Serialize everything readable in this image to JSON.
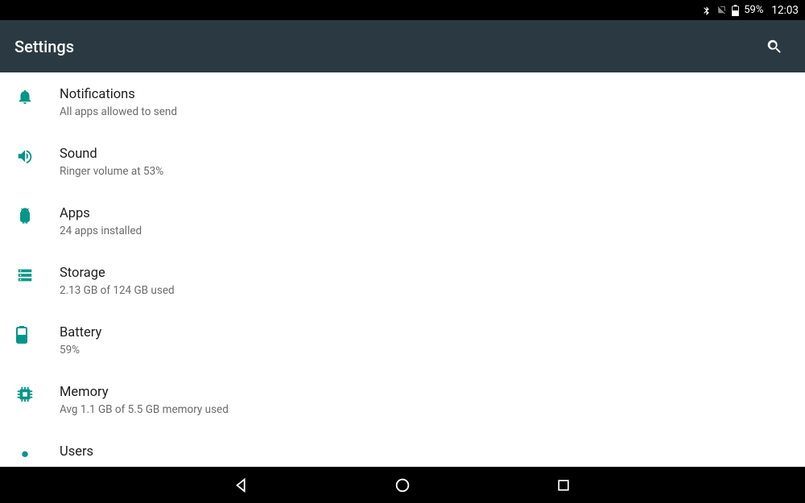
{
  "statusbar": {
    "battery_pct": "59%",
    "time": "12:03"
  },
  "appbar": {
    "title": "Settings"
  },
  "colors": {
    "accent": "#009688"
  },
  "items": [
    {
      "key": "notifications",
      "title": "Notifications",
      "sub": "All apps allowed to send",
      "icon": "bell-icon"
    },
    {
      "key": "sound",
      "title": "Sound",
      "sub": "Ringer volume at 53%",
      "icon": "volume-icon"
    },
    {
      "key": "apps",
      "title": "Apps",
      "sub": "24 apps installed",
      "icon": "android-icon"
    },
    {
      "key": "storage",
      "title": "Storage",
      "sub": "2.13 GB of 124 GB used",
      "icon": "storage-icon"
    },
    {
      "key": "battery",
      "title": "Battery",
      "sub": "59%",
      "icon": "battery-icon"
    },
    {
      "key": "memory",
      "title": "Memory",
      "sub": "Avg 1.1 GB of 5.5 GB memory used",
      "icon": "memory-icon"
    },
    {
      "key": "users",
      "title": "Users",
      "sub": "",
      "icon": "user-icon"
    }
  ]
}
